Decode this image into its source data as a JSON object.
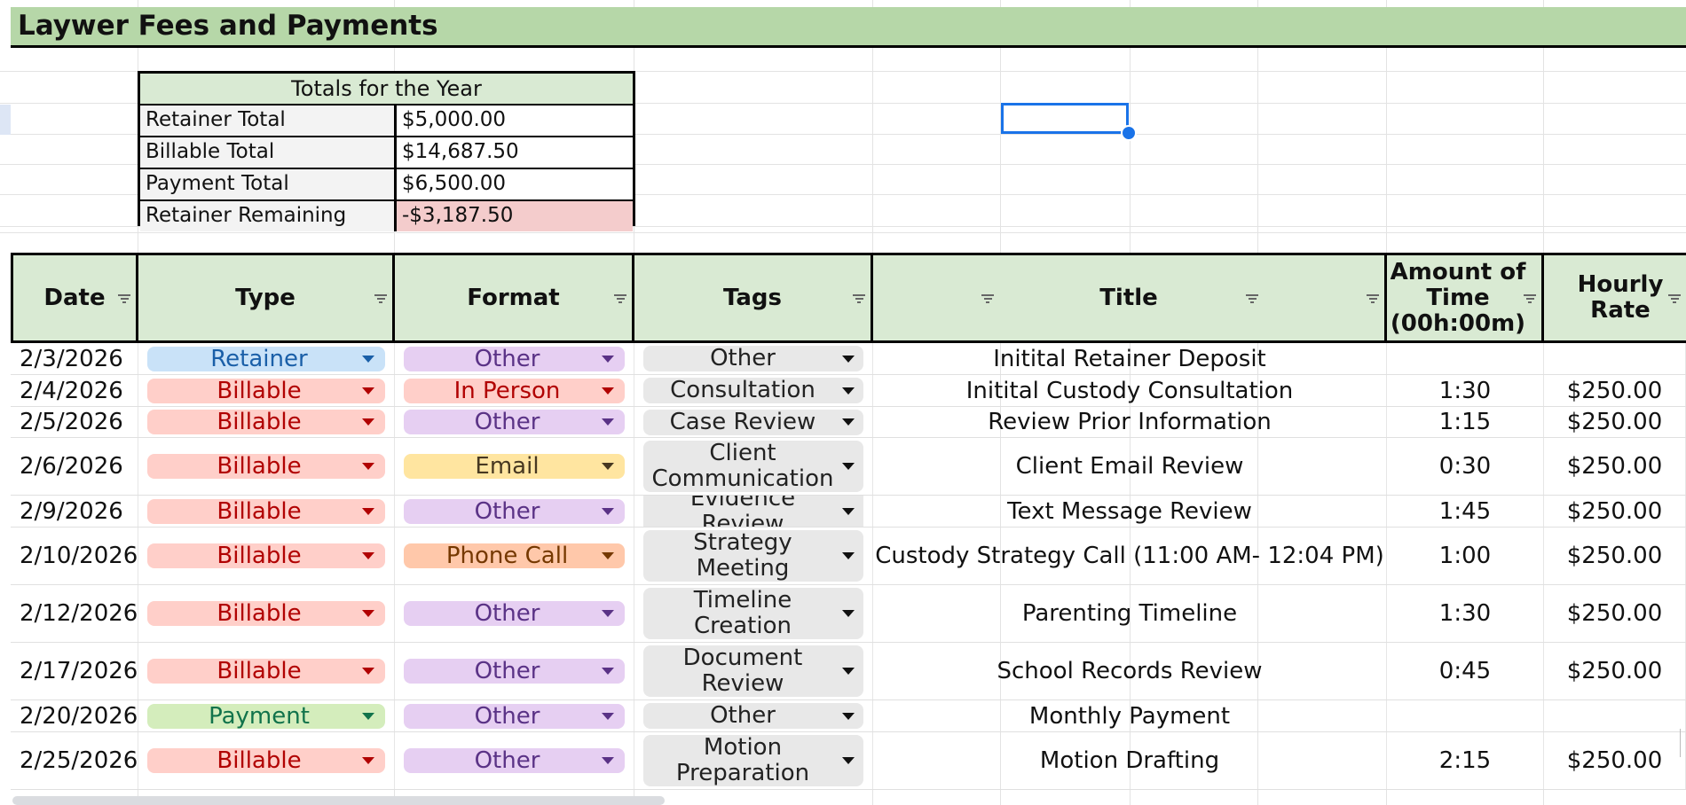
{
  "sheet_title": "Laywer Fees and Payments",
  "totals": {
    "header": "Totals for the Year",
    "rows": [
      {
        "label": "Retainer Total",
        "value": "$5,000.00",
        "negative": false
      },
      {
        "label": "Billable Total",
        "value": "$14,687.50",
        "negative": false
      },
      {
        "label": "Payment Total",
        "value": "$6,500.00",
        "negative": false
      },
      {
        "label": "Retainer Remaining",
        "value": "-$3,187.50",
        "negative": true
      }
    ]
  },
  "headers": {
    "date": "Date",
    "type": "Type",
    "format": "Format",
    "tags": "Tags",
    "title": "Title",
    "amount_time": "Amount of Time (00h:00m)",
    "hourly_rate": "Hourly Rate"
  },
  "chip_styles": {
    "Retainer": {
      "bg": "#c9e2f8",
      "fg": "#1a5fa8",
      "arrow": "#1a5fa8"
    },
    "Billable": {
      "bg": "#ffcfc9",
      "fg": "#b10202",
      "arrow": "#b10202"
    },
    "Payment": {
      "bg": "#d4edbc",
      "fg": "#11734b",
      "arrow": "#11734b"
    },
    "Other": {
      "bg": "#e6cff2",
      "fg": "#5a3286",
      "arrow": "#5a3286"
    },
    "In Person": {
      "bg": "#ffcfc9",
      "fg": "#b10202",
      "arrow": "#b10202"
    },
    "Email": {
      "bg": "#ffe5a0",
      "fg": "#473821",
      "arrow": "#473821"
    },
    "Phone Call": {
      "bg": "#ffc8aa",
      "fg": "#753800",
      "arrow": "#753800"
    }
  },
  "rows": [
    {
      "date": "2/3/2026",
      "type": "Retainer",
      "format": "Other",
      "tag": "Other",
      "title": "Initital Retainer Deposit",
      "time": "",
      "rate": ""
    },
    {
      "date": "2/4/2026",
      "type": "Billable",
      "format": "In Person",
      "tag": "Consultation",
      "title": "Initital Custody Consultation",
      "time": "1:30",
      "rate": "$250.00"
    },
    {
      "date": "2/5/2026",
      "type": "Billable",
      "format": "Other",
      "tag": "Case Review",
      "title": "Review Prior Information",
      "time": "1:15",
      "rate": "$250.00"
    },
    {
      "date": "2/6/2026",
      "type": "Billable",
      "format": "Email",
      "tag": "Client Communication",
      "title": "Client Email Review",
      "time": "0:30",
      "rate": "$250.00"
    },
    {
      "date": "2/9/2026",
      "type": "Billable",
      "format": "Other",
      "tag": "Evidence Review",
      "title": "Text Message Review",
      "time": "1:45",
      "rate": "$250.00"
    },
    {
      "date": "2/10/2026",
      "type": "Billable",
      "format": "Phone Call",
      "tag": "Strategy Meeting",
      "title": "Custody Strategy Call (11:00 AM- 12:04 PM)",
      "time": "1:00",
      "rate": "$250.00"
    },
    {
      "date": "2/12/2026",
      "type": "Billable",
      "format": "Other",
      "tag": "Timeline Creation",
      "title": "Parenting Timeline",
      "time": "1:30",
      "rate": "$250.00"
    },
    {
      "date": "2/17/2026",
      "type": "Billable",
      "format": "Other",
      "tag": "Document Review",
      "title": "School Records Review",
      "time": "0:45",
      "rate": "$250.00"
    },
    {
      "date": "2/20/2026",
      "type": "Payment",
      "format": "Other",
      "tag": "Other",
      "title": "Monthly Payment",
      "time": "",
      "rate": ""
    },
    {
      "date": "2/25/2026",
      "type": "Billable",
      "format": "Other",
      "tag": "Motion Preparation",
      "title": "Motion Drafting",
      "time": "2:15",
      "rate": "$250.00"
    }
  ]
}
